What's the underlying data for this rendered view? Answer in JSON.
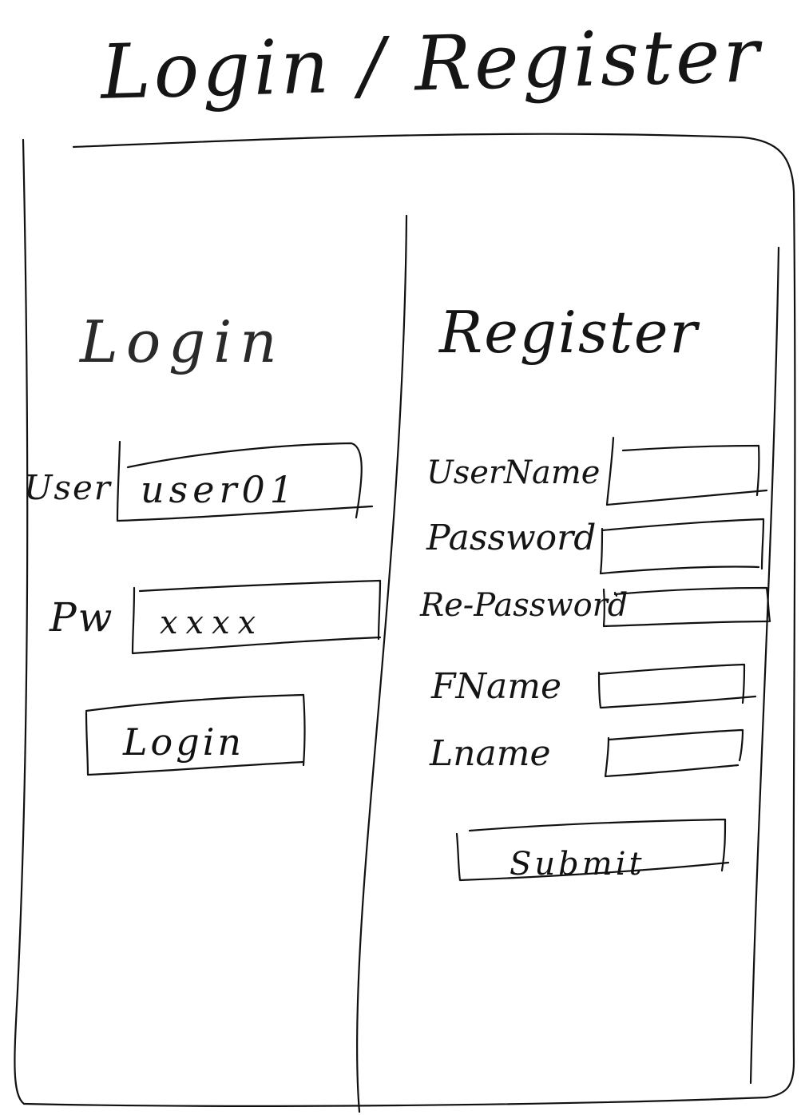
{
  "header": {
    "title": "Login / Register"
  },
  "login": {
    "heading": "Login",
    "user_label": "User",
    "user_value": "user01",
    "password_label": "Pw",
    "password_value": "xxxx",
    "button_label": "Login"
  },
  "register": {
    "heading": "Register",
    "fields": [
      {
        "label": "UserName",
        "value": ""
      },
      {
        "label": "Password",
        "value": ""
      },
      {
        "label": "Re-Password",
        "value": ""
      },
      {
        "label": "FName",
        "value": ""
      },
      {
        "label": "Lname",
        "value": ""
      }
    ],
    "submit_label": "Submit"
  }
}
